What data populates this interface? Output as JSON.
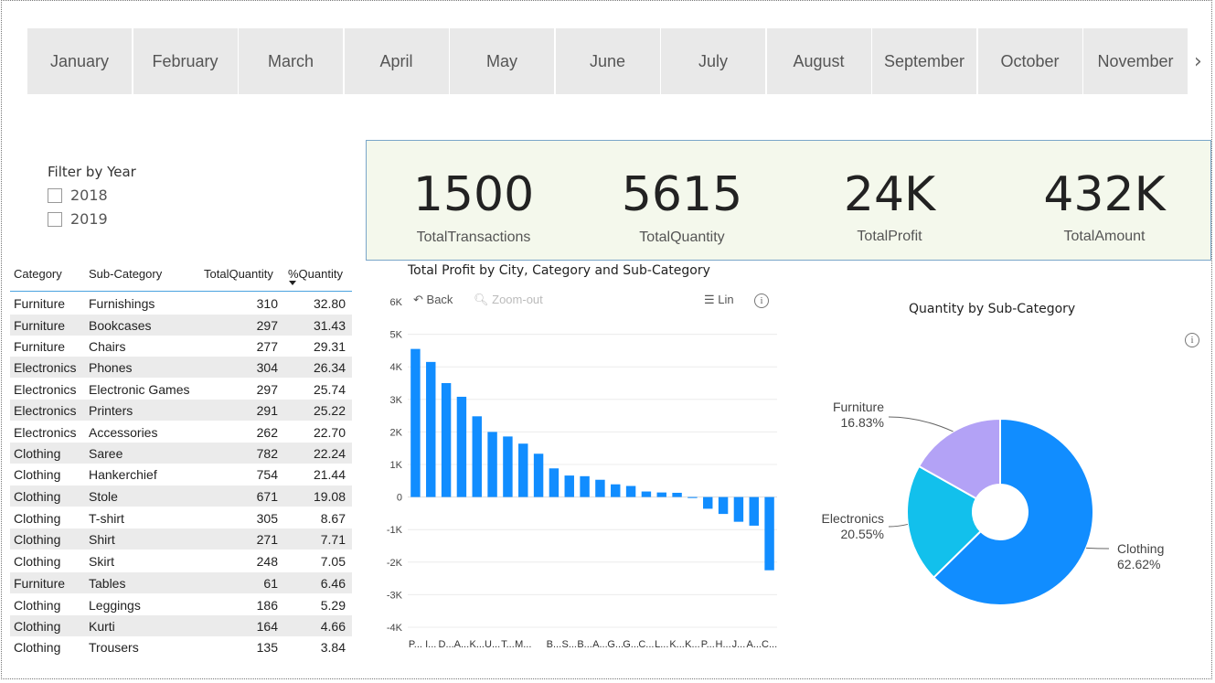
{
  "months": [
    "January",
    "February",
    "March",
    "April",
    "May",
    "June",
    "July",
    "August",
    "September",
    "October",
    "November"
  ],
  "slicer_more_icon": "chevron-right-icon",
  "year_filter": {
    "title": "Filter by Year",
    "options": [
      "2018",
      "2019"
    ]
  },
  "kpis": [
    {
      "value": "1500",
      "label": "TotalTransactions"
    },
    {
      "value": "5615",
      "label": "TotalQuantity"
    },
    {
      "value": "24K",
      "label": "TotalProfit"
    },
    {
      "value": "432K",
      "label": "TotalAmount"
    }
  ],
  "table": {
    "headers": [
      "Category",
      "Sub-Category",
      "TotalQuantity",
      "%Quantity"
    ],
    "rows": [
      [
        "Furniture",
        "Furnishings",
        "310",
        "32.80"
      ],
      [
        "Furniture",
        "Bookcases",
        "297",
        "31.43"
      ],
      [
        "Furniture",
        "Chairs",
        "277",
        "29.31"
      ],
      [
        "Electronics",
        "Phones",
        "304",
        "26.34"
      ],
      [
        "Electronics",
        "Electronic Games",
        "297",
        "25.74"
      ],
      [
        "Electronics",
        "Printers",
        "291",
        "25.22"
      ],
      [
        "Electronics",
        "Accessories",
        "262",
        "22.70"
      ],
      [
        "Clothing",
        "Saree",
        "782",
        "22.24"
      ],
      [
        "Clothing",
        "Hankerchief",
        "754",
        "21.44"
      ],
      [
        "Clothing",
        "Stole",
        "671",
        "19.08"
      ],
      [
        "Clothing",
        "T-shirt",
        "305",
        "8.67"
      ],
      [
        "Clothing",
        "Shirt",
        "271",
        "7.71"
      ],
      [
        "Clothing",
        "Skirt",
        "248",
        "7.05"
      ],
      [
        "Furniture",
        "Tables",
        "61",
        "6.46"
      ],
      [
        "Clothing",
        "Leggings",
        "186",
        "5.29"
      ],
      [
        "Clothing",
        "Kurti",
        "164",
        "4.66"
      ],
      [
        "Clothing",
        "Trousers",
        "135",
        "3.84"
      ]
    ]
  },
  "bar_toolbar": {
    "back": "Back",
    "zoom_out": "Zoom-out",
    "lin": "Lin"
  },
  "chart_data": [
    {
      "type": "bar",
      "title": "Total Profit by City, Category and Sub-Category",
      "ylim": [
        -4000,
        6000
      ],
      "yticks": [
        {
          "v": 6000,
          "label": "6K"
        },
        {
          "v": 5000,
          "label": "5K"
        },
        {
          "v": 4000,
          "label": "4K"
        },
        {
          "v": 3000,
          "label": "3K"
        },
        {
          "v": 2000,
          "label": "2K"
        },
        {
          "v": 1000,
          "label": "1K"
        },
        {
          "v": 0,
          "label": "0"
        },
        {
          "v": -1000,
          "label": "-1K"
        },
        {
          "v": -2000,
          "label": "-2K"
        },
        {
          "v": -3000,
          "label": "-3K"
        },
        {
          "v": -4000,
          "label": "-4K"
        }
      ],
      "categories": [
        "P...",
        "I...",
        "D...",
        "A...",
        "K...",
        "U...",
        "T...",
        "M...",
        "",
        "B...",
        "S...",
        "B...",
        "A...",
        "G...",
        "G...",
        "C...",
        "L...",
        "K...",
        "K...",
        "P...",
        "H...",
        "J...",
        "A...",
        "C..."
      ],
      "values": [
        4550,
        4150,
        3500,
        3080,
        2480,
        2000,
        1860,
        1640,
        1330,
        880,
        660,
        640,
        530,
        390,
        340,
        170,
        140,
        130,
        -30,
        -360,
        -520,
        -760,
        -880,
        -2250
      ],
      "grid": true,
      "color": "#118dff"
    },
    {
      "type": "pie",
      "title": "Quantity by Sub-Category",
      "slices": [
        {
          "label": "Clothing",
          "pct_label": "62.62%",
          "value": 62.62,
          "color": "#118dff"
        },
        {
          "label": "Electronics",
          "pct_label": "20.55%",
          "value": 20.55,
          "color": "#12c0ec"
        },
        {
          "label": "Furniture",
          "pct_label": "16.83%",
          "value": 16.83,
          "color": "#b3a2f6"
        }
      ],
      "donut": true
    }
  ]
}
